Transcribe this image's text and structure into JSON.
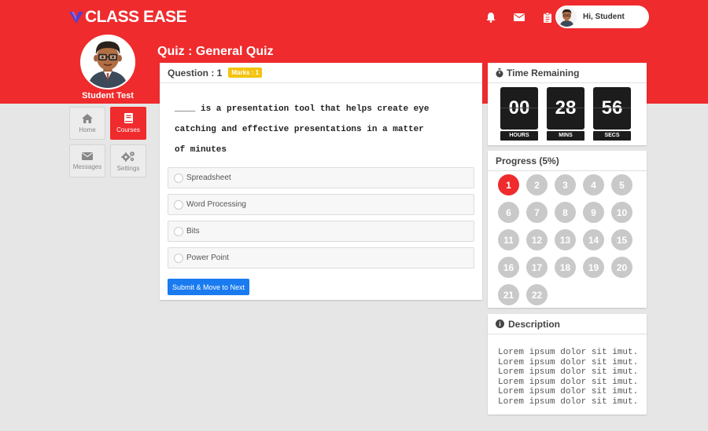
{
  "header": {
    "logo_text": "CLASS EASE",
    "greeting": "Hi, Student",
    "icons": [
      "bell-icon",
      "envelope-icon",
      "clipboard-icon"
    ]
  },
  "profile": {
    "name": "Student Test"
  },
  "nav": {
    "items": [
      {
        "label": "Home",
        "icon": "home-icon",
        "active": false
      },
      {
        "label": "Courses",
        "icon": "book-icon",
        "active": true
      },
      {
        "label": "Messages",
        "icon": "envelope-icon",
        "active": false
      },
      {
        "label": "Settings",
        "icon": "gears-icon",
        "active": false
      }
    ]
  },
  "quiz": {
    "title": "Quiz : General Quiz",
    "question_label": "Question : 1",
    "marks_badge": "Marks : 1",
    "question_lines": [
      "____ is a presentation tool that helps create eye",
      "catching and effective presentations in a matter",
      "of minutes"
    ],
    "options": [
      "Spreadsheet",
      "Word Processing",
      "Bits",
      "Power Point"
    ],
    "submit_label": "Submit & Move to Next"
  },
  "timer": {
    "title": "Time Remaining",
    "hours": "00",
    "mins": "28",
    "secs": "56",
    "labels": {
      "hours": "HOURS",
      "mins": "MINS",
      "secs": "SECS"
    }
  },
  "progress": {
    "title": "Progress (5%)",
    "current": 1,
    "numbers": [
      "1",
      "2",
      "3",
      "4",
      "5",
      "6",
      "7",
      "8",
      "9",
      "10",
      "11",
      "12",
      "13",
      "14",
      "15",
      "16",
      "17",
      "18",
      "19",
      "20",
      "21",
      "22"
    ]
  },
  "description": {
    "title": "Description",
    "lines": [
      "Lorem ipsum dolor sit imut.",
      "Lorem ipsum dolor sit imut.",
      "Lorem ipsum dolor sit imut.",
      "Lorem ipsum dolor sit imut.",
      "Lorem ipsum dolor sit imut.",
      "Lorem ipsum dolor sit imut."
    ]
  },
  "colors": {
    "brand": "#ef2b2d",
    "accent": "#1a7bf0",
    "badge": "#f5c30f"
  }
}
